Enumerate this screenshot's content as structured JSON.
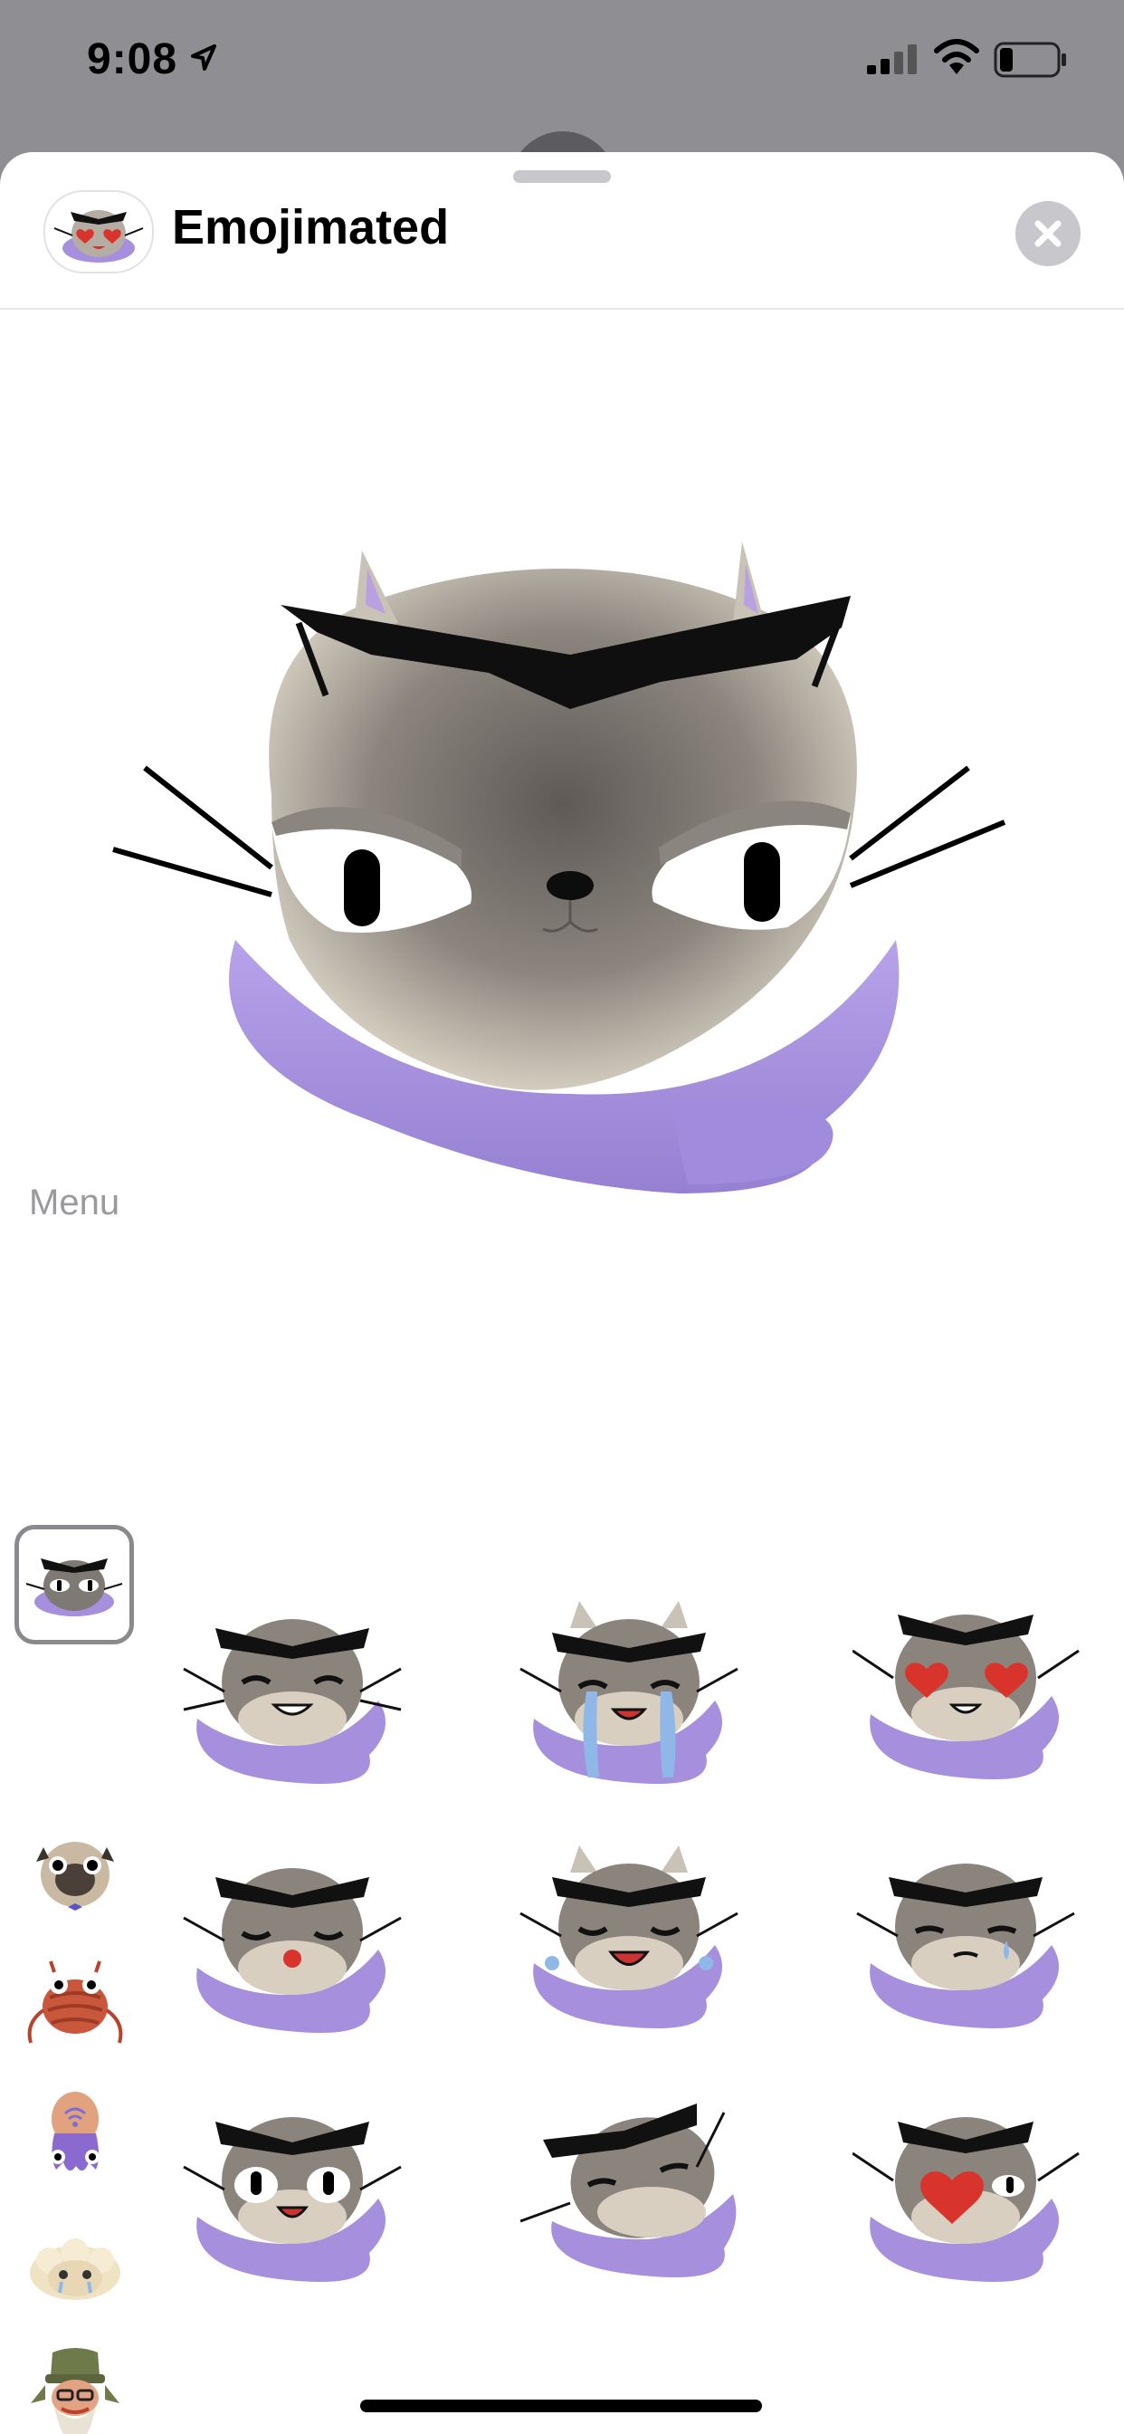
{
  "status_bar": {
    "time": "9:08",
    "icons": [
      "location-arrow-icon",
      "cellular-signal-icon",
      "wifi-icon",
      "battery-icon"
    ]
  },
  "header": {
    "app_name": "Emojimated",
    "app_icon": "cat-heart-eyes-icon",
    "close_icon": "close-icon"
  },
  "preview": {
    "sticker": "cat-sunglasses-scarf-squint"
  },
  "menu": {
    "label": "Menu"
  },
  "sidebar": {
    "items": [
      {
        "name": "cat-pack",
        "selected": true
      },
      {
        "name": "pug-pack",
        "selected": false
      },
      {
        "name": "crab-pack",
        "selected": false
      },
      {
        "name": "octopus-pack",
        "selected": false
      },
      {
        "name": "sheep-pack",
        "selected": false
      },
      {
        "name": "wizard-pack",
        "selected": false
      }
    ]
  },
  "stickers": [
    {
      "name": "cat-laughing"
    },
    {
      "name": "cat-crying"
    },
    {
      "name": "cat-heart-eyes"
    },
    {
      "name": "cat-kiss"
    },
    {
      "name": "cat-laugh-tears"
    },
    {
      "name": "cat-sad-tear"
    },
    {
      "name": "cat-shocked"
    },
    {
      "name": "cat-sleepy-tilt"
    },
    {
      "name": "cat-heart-wink"
    }
  ],
  "colors": {
    "scarf": "#a68fdc",
    "fur_light": "#d8cfc0",
    "fur_dark": "#6e6a66",
    "glasses": "#111111",
    "ear_inner": "#b9a0e0",
    "heart": "#d8342c",
    "tear": "#8fb8e8"
  }
}
